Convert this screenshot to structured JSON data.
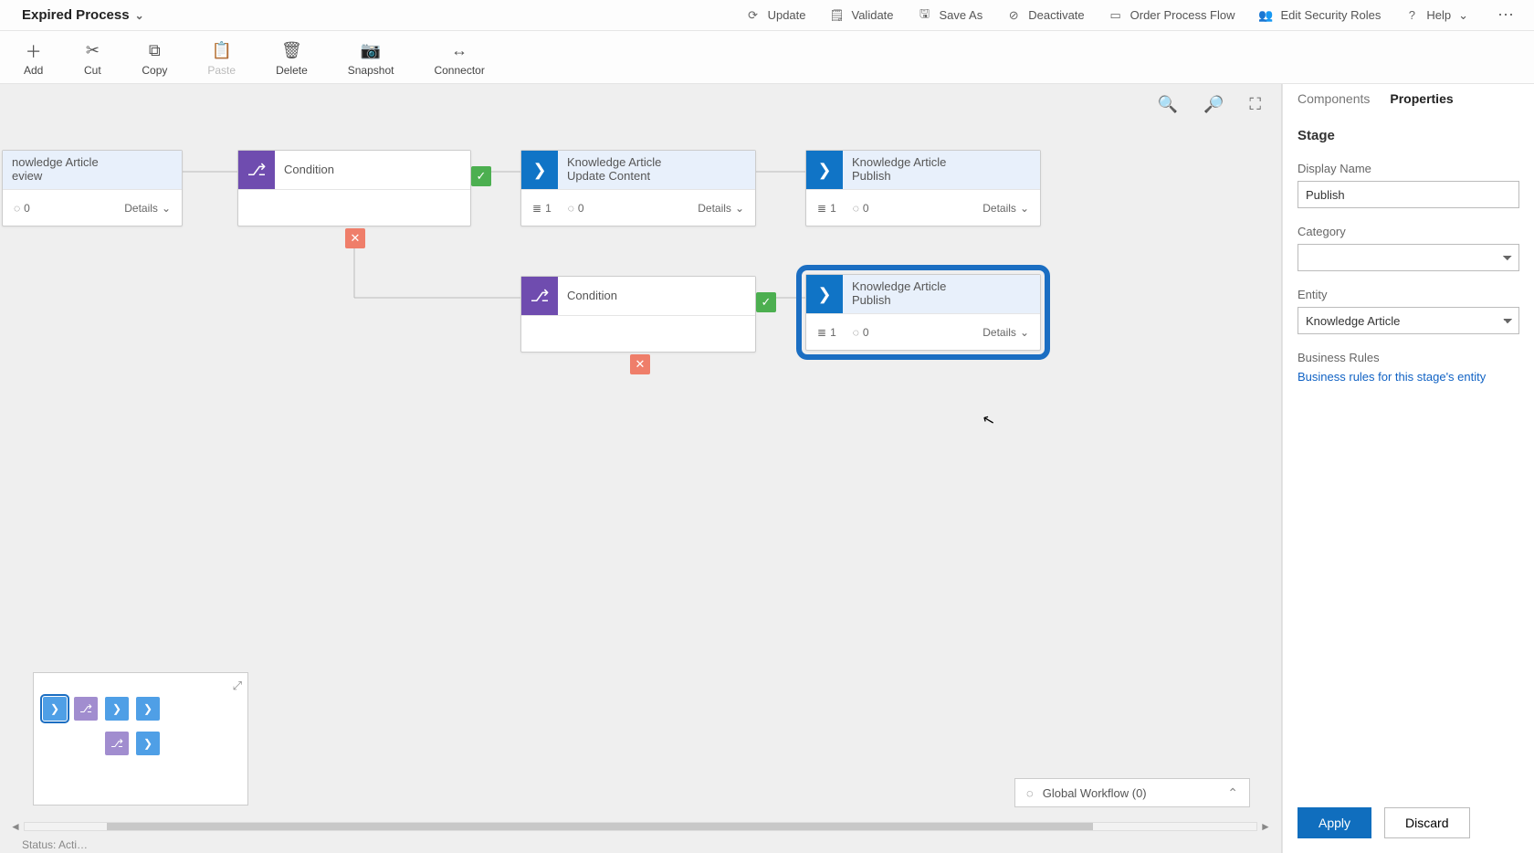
{
  "title": "Expired Process",
  "commands": {
    "update": "Update",
    "validate": "Validate",
    "saveAs": "Save As",
    "deactivate": "Deactivate",
    "order": "Order Process Flow",
    "security": "Edit Security Roles",
    "help": "Help"
  },
  "toolbar": {
    "add": "Add",
    "cut": "Cut",
    "copy": "Copy",
    "paste": "Paste",
    "delete": "Delete",
    "snapshot": "Snapshot",
    "connector": "Connector"
  },
  "nodes": {
    "review": {
      "line1": "nowledge Article",
      "line2": "eview",
      "steps": "0",
      "triggers": "",
      "details": "Details"
    },
    "cond1": {
      "title": "Condition"
    },
    "update": {
      "line1": "Knowledge Article",
      "line2": "Update Content",
      "steps": "1",
      "triggers": "0",
      "details": "Details"
    },
    "publish1": {
      "line1": "Knowledge Article",
      "line2": "Publish",
      "steps": "1",
      "triggers": "0",
      "details": "Details"
    },
    "cond2": {
      "title": "Condition"
    },
    "publish2": {
      "line1": "Knowledge Article",
      "line2": "Publish",
      "steps": "1",
      "triggers": "0",
      "details": "Details"
    }
  },
  "globalWorkflow": "Global Workflow (0)",
  "panel": {
    "tabComponents": "Components",
    "tabProperties": "Properties",
    "heading": "Stage",
    "displayNameLabel": "Display Name",
    "displayNameValue": "Publish",
    "categoryLabel": "Category",
    "categoryValue": "",
    "entityLabel": "Entity",
    "entityValue": "Knowledge Article",
    "rulesLabel": "Business Rules",
    "rulesLink": "Business rules for this stage's entity",
    "apply": "Apply",
    "discard": "Discard"
  },
  "status": "Status: Acti…"
}
